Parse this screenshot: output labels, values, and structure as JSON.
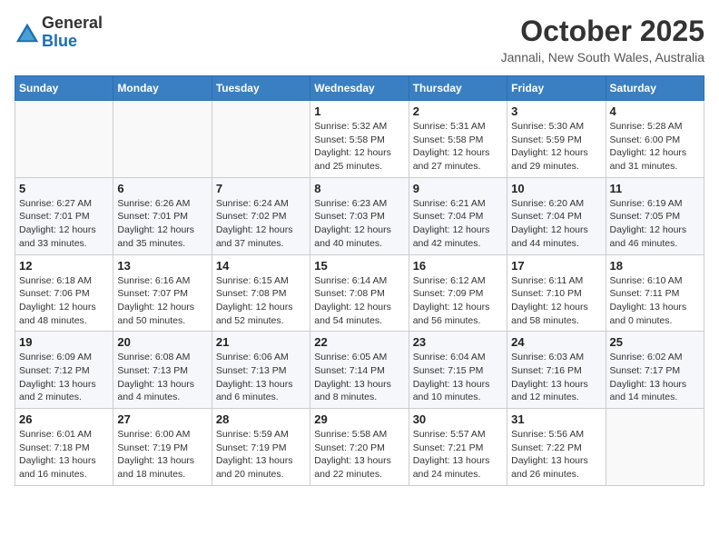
{
  "header": {
    "logo_general": "General",
    "logo_blue": "Blue",
    "month_title": "October 2025",
    "location": "Jannali, New South Wales, Australia"
  },
  "days_of_week": [
    "Sunday",
    "Monday",
    "Tuesday",
    "Wednesday",
    "Thursday",
    "Friday",
    "Saturday"
  ],
  "weeks": [
    [
      {
        "num": "",
        "info": ""
      },
      {
        "num": "",
        "info": ""
      },
      {
        "num": "",
        "info": ""
      },
      {
        "num": "1",
        "info": "Sunrise: 5:32 AM\nSunset: 5:58 PM\nDaylight: 12 hours\nand 25 minutes."
      },
      {
        "num": "2",
        "info": "Sunrise: 5:31 AM\nSunset: 5:58 PM\nDaylight: 12 hours\nand 27 minutes."
      },
      {
        "num": "3",
        "info": "Sunrise: 5:30 AM\nSunset: 5:59 PM\nDaylight: 12 hours\nand 29 minutes."
      },
      {
        "num": "4",
        "info": "Sunrise: 5:28 AM\nSunset: 6:00 PM\nDaylight: 12 hours\nand 31 minutes."
      }
    ],
    [
      {
        "num": "5",
        "info": "Sunrise: 6:27 AM\nSunset: 7:01 PM\nDaylight: 12 hours\nand 33 minutes."
      },
      {
        "num": "6",
        "info": "Sunrise: 6:26 AM\nSunset: 7:01 PM\nDaylight: 12 hours\nand 35 minutes."
      },
      {
        "num": "7",
        "info": "Sunrise: 6:24 AM\nSunset: 7:02 PM\nDaylight: 12 hours\nand 37 minutes."
      },
      {
        "num": "8",
        "info": "Sunrise: 6:23 AM\nSunset: 7:03 PM\nDaylight: 12 hours\nand 40 minutes."
      },
      {
        "num": "9",
        "info": "Sunrise: 6:21 AM\nSunset: 7:04 PM\nDaylight: 12 hours\nand 42 minutes."
      },
      {
        "num": "10",
        "info": "Sunrise: 6:20 AM\nSunset: 7:04 PM\nDaylight: 12 hours\nand 44 minutes."
      },
      {
        "num": "11",
        "info": "Sunrise: 6:19 AM\nSunset: 7:05 PM\nDaylight: 12 hours\nand 46 minutes."
      }
    ],
    [
      {
        "num": "12",
        "info": "Sunrise: 6:18 AM\nSunset: 7:06 PM\nDaylight: 12 hours\nand 48 minutes."
      },
      {
        "num": "13",
        "info": "Sunrise: 6:16 AM\nSunset: 7:07 PM\nDaylight: 12 hours\nand 50 minutes."
      },
      {
        "num": "14",
        "info": "Sunrise: 6:15 AM\nSunset: 7:08 PM\nDaylight: 12 hours\nand 52 minutes."
      },
      {
        "num": "15",
        "info": "Sunrise: 6:14 AM\nSunset: 7:08 PM\nDaylight: 12 hours\nand 54 minutes."
      },
      {
        "num": "16",
        "info": "Sunrise: 6:12 AM\nSunset: 7:09 PM\nDaylight: 12 hours\nand 56 minutes."
      },
      {
        "num": "17",
        "info": "Sunrise: 6:11 AM\nSunset: 7:10 PM\nDaylight: 12 hours\nand 58 minutes."
      },
      {
        "num": "18",
        "info": "Sunrise: 6:10 AM\nSunset: 7:11 PM\nDaylight: 13 hours\nand 0 minutes."
      }
    ],
    [
      {
        "num": "19",
        "info": "Sunrise: 6:09 AM\nSunset: 7:12 PM\nDaylight: 13 hours\nand 2 minutes."
      },
      {
        "num": "20",
        "info": "Sunrise: 6:08 AM\nSunset: 7:13 PM\nDaylight: 13 hours\nand 4 minutes."
      },
      {
        "num": "21",
        "info": "Sunrise: 6:06 AM\nSunset: 7:13 PM\nDaylight: 13 hours\nand 6 minutes."
      },
      {
        "num": "22",
        "info": "Sunrise: 6:05 AM\nSunset: 7:14 PM\nDaylight: 13 hours\nand 8 minutes."
      },
      {
        "num": "23",
        "info": "Sunrise: 6:04 AM\nSunset: 7:15 PM\nDaylight: 13 hours\nand 10 minutes."
      },
      {
        "num": "24",
        "info": "Sunrise: 6:03 AM\nSunset: 7:16 PM\nDaylight: 13 hours\nand 12 minutes."
      },
      {
        "num": "25",
        "info": "Sunrise: 6:02 AM\nSunset: 7:17 PM\nDaylight: 13 hours\nand 14 minutes."
      }
    ],
    [
      {
        "num": "26",
        "info": "Sunrise: 6:01 AM\nSunset: 7:18 PM\nDaylight: 13 hours\nand 16 minutes."
      },
      {
        "num": "27",
        "info": "Sunrise: 6:00 AM\nSunset: 7:19 PM\nDaylight: 13 hours\nand 18 minutes."
      },
      {
        "num": "28",
        "info": "Sunrise: 5:59 AM\nSunset: 7:19 PM\nDaylight: 13 hours\nand 20 minutes."
      },
      {
        "num": "29",
        "info": "Sunrise: 5:58 AM\nSunset: 7:20 PM\nDaylight: 13 hours\nand 22 minutes."
      },
      {
        "num": "30",
        "info": "Sunrise: 5:57 AM\nSunset: 7:21 PM\nDaylight: 13 hours\nand 24 minutes."
      },
      {
        "num": "31",
        "info": "Sunrise: 5:56 AM\nSunset: 7:22 PM\nDaylight: 13 hours\nand 26 minutes."
      },
      {
        "num": "",
        "info": ""
      }
    ]
  ]
}
